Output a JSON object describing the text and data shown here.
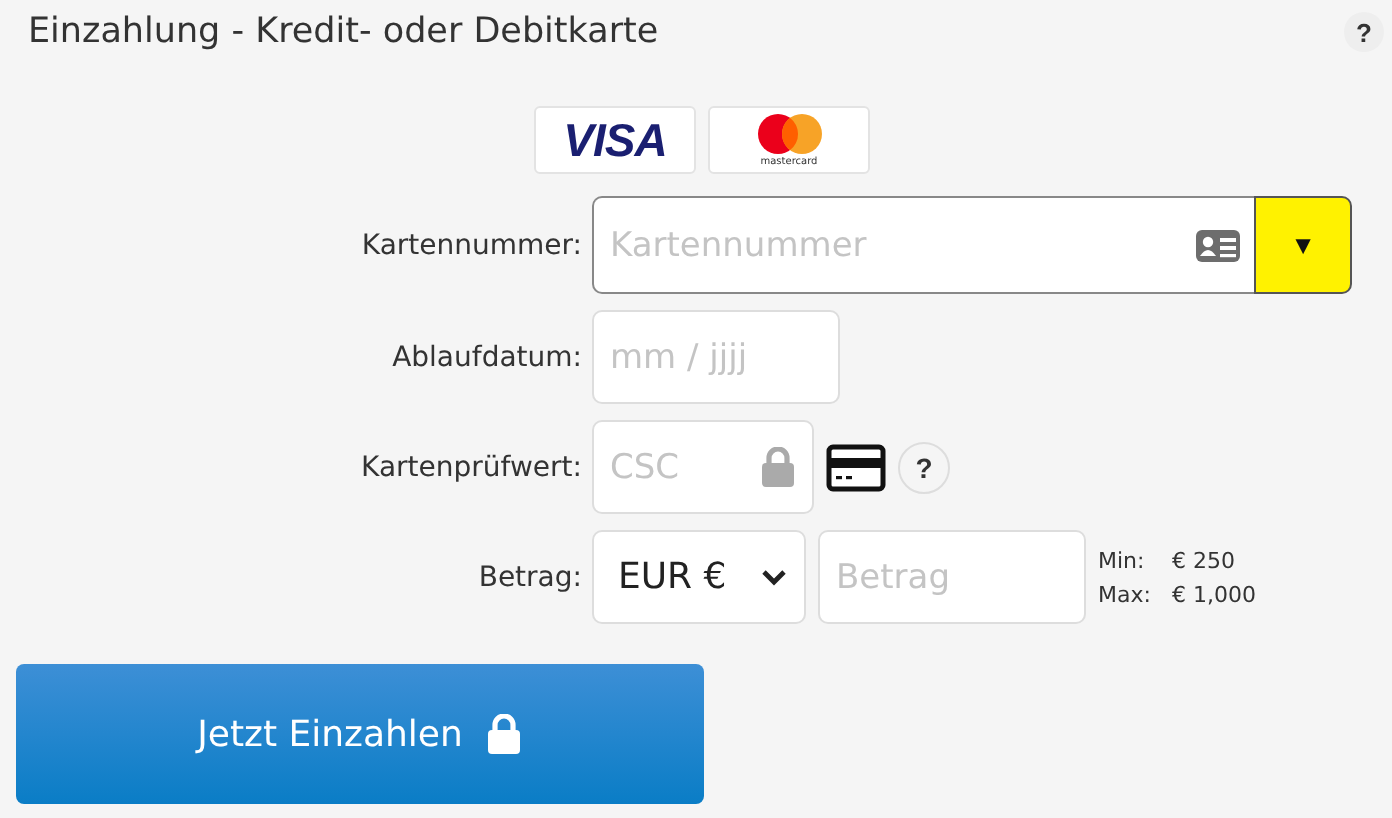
{
  "title": "Einzahlung - Kredit- oder Debitkarte",
  "help": "?",
  "card_brands": [
    {
      "kind": "visa",
      "label": "VISA"
    },
    {
      "kind": "mastercard",
      "label": "mastercard"
    }
  ],
  "fields": [
    {
      "kind": "card_number",
      "label": "Kartennummer:",
      "placeholder": "Kartennummer",
      "dropdown": "▼"
    },
    {
      "kind": "expiry",
      "label": "Ablaufdatum:",
      "placeholder": "mm / jjjj"
    },
    {
      "kind": "csc",
      "label": "Kartenprüfwert:",
      "placeholder": "CSC",
      "help": "?"
    },
    {
      "kind": "amount",
      "label": "Betrag:",
      "currency": "EUR €",
      "placeholder": "Betrag",
      "limits": [
        {
          "label": "Min:",
          "value": "€ 250"
        },
        {
          "label": "Max:",
          "value": "€ 1,000"
        }
      ]
    }
  ],
  "submit": "Jetzt Einzahlen"
}
